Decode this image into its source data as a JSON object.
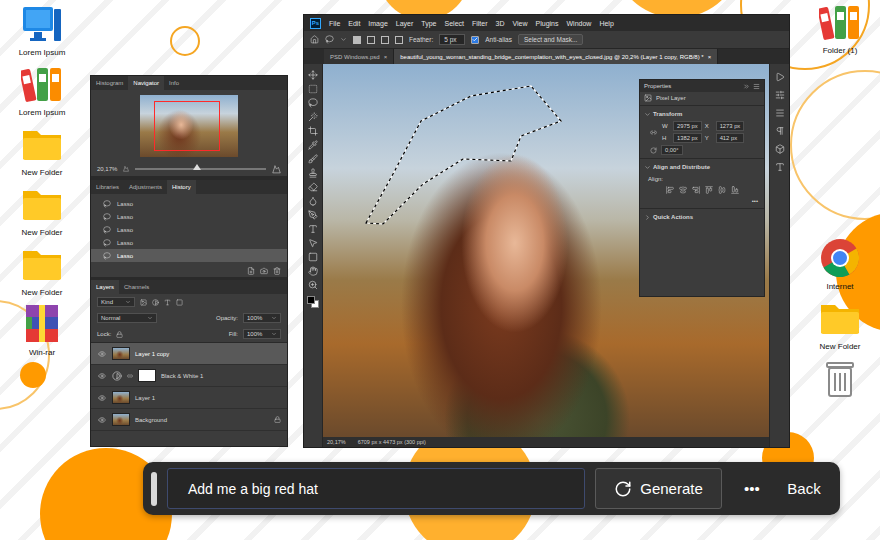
{
  "desktop": {
    "left_icons": [
      {
        "label": "Lorem Ipsum",
        "kind": "monitor"
      },
      {
        "label": "Lorem Ipsum",
        "kind": "binders"
      },
      {
        "label": "New Folder",
        "kind": "folder"
      },
      {
        "label": "New Folder",
        "kind": "folder"
      },
      {
        "label": "New Folder",
        "kind": "folder"
      },
      {
        "label": "Win-rar",
        "kind": "winrar"
      }
    ],
    "right_icons": [
      {
        "label": "Folder (1)",
        "kind": "binders"
      },
      {
        "label": "Internet",
        "kind": "chrome"
      },
      {
        "label": "New Folder",
        "kind": "folder"
      },
      {
        "kind": "trash"
      }
    ]
  },
  "photoshop": {
    "logo": "Ps",
    "menu": [
      "File",
      "Edit",
      "Image",
      "Layer",
      "Type",
      "Select",
      "Filter",
      "3D",
      "View",
      "Plugins",
      "Window",
      "Help"
    ],
    "options": {
      "feather_label": "Feather:",
      "feather_value": "5 px",
      "anti_alias": {
        "label": "Anti-alias",
        "checked": true
      },
      "select_and_mask": "Select and Mask..."
    },
    "tab_close": "×",
    "tabs": [
      {
        "label": "PSD Windows.psd",
        "selected": false
      },
      {
        "label": "beautiful_young_woman_standing_bridge_contemplation_with_eyes_closed.jpg @ 20,2% (Layer 1 copy, RGB/8) *",
        "selected": true
      }
    ],
    "properties": {
      "title": "Properties",
      "layer_type": "Pixel Layer",
      "transform": "Transform",
      "fields": [
        {
          "label": "W",
          "value": "2975 px"
        },
        {
          "label": "X",
          "value": "1273 px"
        },
        {
          "label": "H",
          "value": "1382 px"
        },
        {
          "label": "Y",
          "value": "412 px"
        }
      ],
      "angle": "0,00°",
      "align_title": "Align and Distribute",
      "align_label": "Align:",
      "more": "•••",
      "quick_actions": "Quick Actions"
    },
    "status": {
      "zoom": "20,17%",
      "size": "6709 px x 4473 px (300 ppi)"
    }
  },
  "panel": {
    "top_tabs": [
      {
        "label": "Histogram",
        "selected": false
      },
      {
        "label": "Navigator",
        "selected": true
      },
      {
        "label": "Info",
        "selected": false
      }
    ],
    "zoom": "20,17%",
    "zoom_level": 0.47,
    "mid_tabs": [
      {
        "label": "Libraries",
        "selected": false
      },
      {
        "label": "Adjustments",
        "selected": false
      },
      {
        "label": "History",
        "selected": true
      }
    ],
    "history": [
      {
        "label": "Lasso",
        "selected": false
      },
      {
        "label": "Lasso",
        "selected": false
      },
      {
        "label": "Lasso",
        "selected": false
      },
      {
        "label": "Lasso",
        "selected": false
      },
      {
        "label": "Lasso",
        "selected": true
      }
    ],
    "layer_tabs": [
      {
        "label": "Layers",
        "selected": true
      },
      {
        "label": "Channels",
        "selected": false
      }
    ],
    "kind": "Kind",
    "blend": "Normal",
    "opacity_label": "Opacity:",
    "opacity": "100%",
    "lock_label": "Lock:",
    "fill_label": "Fill:",
    "fill": "100%",
    "layers": [
      {
        "name": "Layer 1 copy",
        "kind": "photo",
        "selected": true,
        "visible": true,
        "locked": false
      },
      {
        "name": "Black & White 1",
        "kind": "adjustment",
        "selected": false,
        "visible": true,
        "locked": false
      },
      {
        "name": "Layer 1",
        "kind": "photo",
        "selected": false,
        "visible": true,
        "locked": false
      },
      {
        "name": "Background",
        "kind": "photo",
        "selected": false,
        "visible": true,
        "locked": true
      }
    ]
  },
  "prompt": {
    "value": "Add me a big red hat",
    "generate": "Generate",
    "more": "•••",
    "back": "Back"
  }
}
